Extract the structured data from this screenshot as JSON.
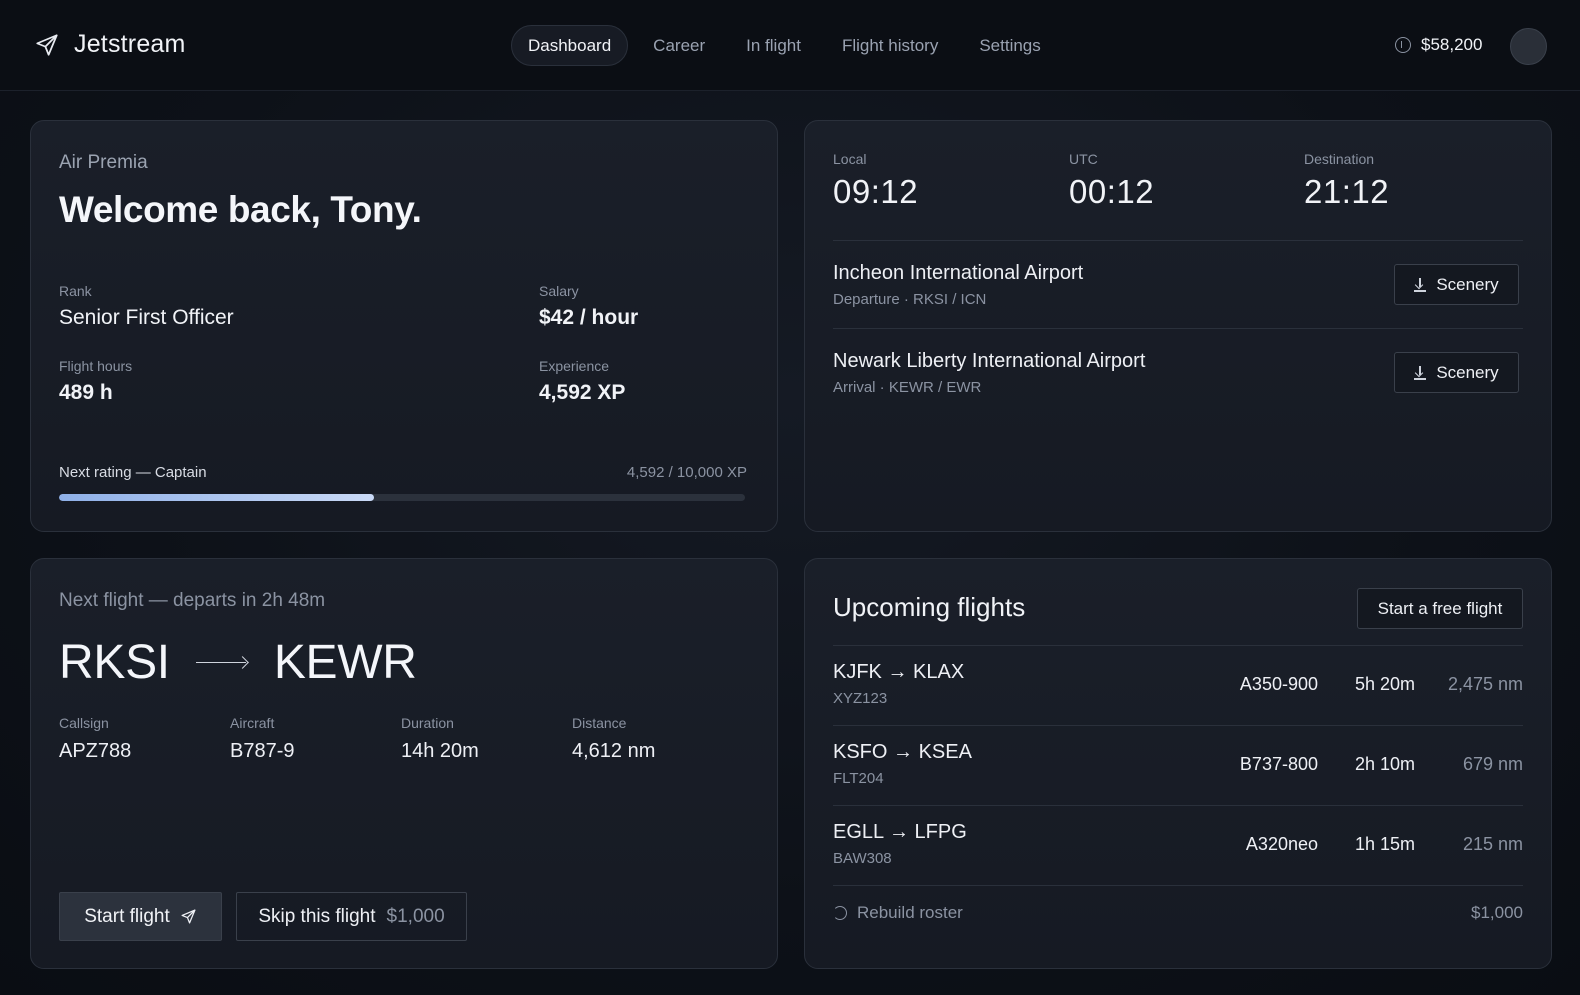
{
  "brand": {
    "name": "Jetstream",
    "icon": "paper-plane-icon"
  },
  "nav": [
    {
      "label": "Dashboard",
      "active": true
    },
    {
      "label": "Career"
    },
    {
      "label": "In flight"
    },
    {
      "label": "Flight history"
    },
    {
      "label": "Settings"
    }
  ],
  "balance": "$58,200",
  "welcome": {
    "airline": "Air Premia",
    "title": "Welcome back, Tony.",
    "rank_label": "Rank",
    "rank": "Senior First Officer",
    "salary_label": "Salary",
    "salary": "$42 / hour",
    "hours_label": "Flight hours",
    "hours": "489 h",
    "xp_label": "Experience",
    "xp": "4,592 XP",
    "next_rating": "Next rating — Captain",
    "progress_text": "4,592 / 10,000 XP",
    "progress_fraction": 0.4592
  },
  "clocks": {
    "local_label": "Local",
    "local": "09:12",
    "utc_label": "UTC",
    "utc": "00:12",
    "dest_label": "Destination",
    "dest": "21:12"
  },
  "airports": [
    {
      "name": "Incheon International Airport",
      "sub": "Departure · RKSI / ICN",
      "button": "Scenery"
    },
    {
      "name": "Newark Liberty International Airport",
      "sub": "Arrival · KEWR / EWR",
      "button": "Scenery"
    }
  ],
  "next_flight": {
    "title": "Next flight — departs in 2h 48m",
    "from": "RKSI",
    "to": "KEWR",
    "callsign_label": "Callsign",
    "callsign": "APZ788",
    "aircraft_label": "Aircraft",
    "aircraft": "B787-9",
    "duration_label": "Duration",
    "duration": "14h 20m",
    "distance_label": "Distance",
    "distance": "4,612 nm",
    "start_label": "Start flight",
    "skip_label": "Skip this flight",
    "skip_cost": "$1,000"
  },
  "upcoming": {
    "title": "Upcoming flights",
    "free_flight_label": "Start a free flight",
    "rows": [
      {
        "route": "KJFK → KLAX",
        "callsign": "XYZ123",
        "aircraft": "A350-900",
        "duration": "5h 20m",
        "distance": "2,475 nm"
      },
      {
        "route": "KSFO → KSEA",
        "callsign": "FLT204",
        "aircraft": "B737-800",
        "duration": "2h 10m",
        "distance": "679 nm"
      },
      {
        "route": "EGLL → LFPG",
        "callsign": "BAW308",
        "aircraft": "A320neo",
        "duration": "1h 15m",
        "distance": "215 nm"
      }
    ],
    "rebuild_label": "Rebuild roster",
    "rebuild_cost": "$1,000"
  }
}
